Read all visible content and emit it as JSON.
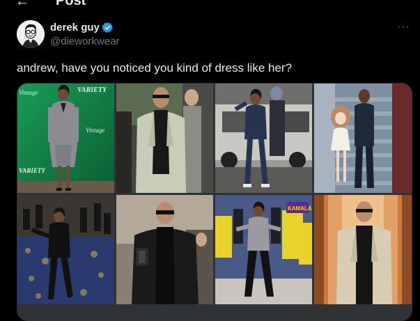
{
  "header": {
    "back_icon": "arrow-left-icon",
    "title": "Post"
  },
  "author": {
    "display_name": "derek guy",
    "handle": "@dieworkwear",
    "verified_icon": "verified-badge-icon",
    "avatar": "illustrated-man-glasses-avatar"
  },
  "more_label": "···",
  "tweet": {
    "text": "andrew, have you noticed you kind of dress like her?"
  },
  "media": {
    "tiles": [
      {
        "desc": "woman in gray blazer on green Variety backdrop",
        "text1": "Vintage",
        "text2": "VARIETY",
        "text3": "Vintage",
        "text4": "VARIETY"
      },
      {
        "desc": "bald man in light green suit"
      },
      {
        "desc": "woman in navy suit next to van"
      },
      {
        "desc": "man with anime girl cutout on stairs"
      },
      {
        "desc": "woman dancing on patterned carpet"
      },
      {
        "desc": "bald man in black jacket with sunglasses"
      },
      {
        "desc": "woman dancing with crowd in yellow shirts",
        "sign_text": "KAMALA"
      },
      {
        "desc": "man in beige jacket in hallway"
      }
    ]
  },
  "colors": {
    "background": "#000000",
    "text": "#e7e9ea",
    "muted": "#71767b",
    "verified": "#1d9bf0"
  }
}
